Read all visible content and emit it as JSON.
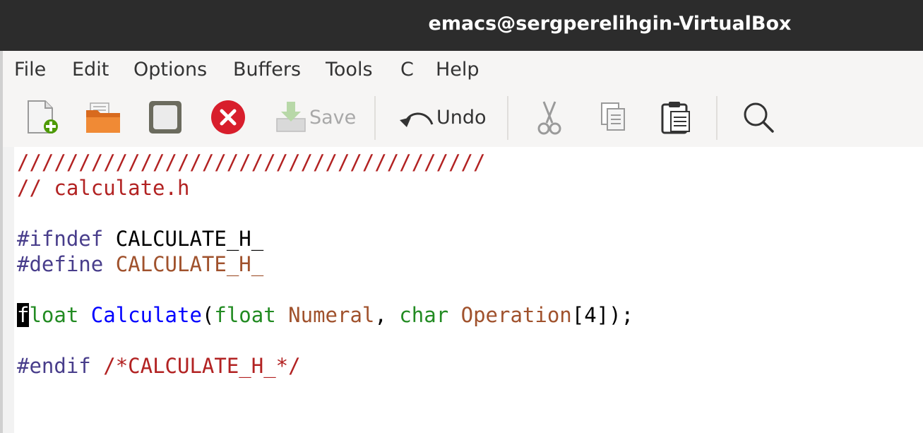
{
  "window": {
    "title": "emacs@sergperelihgin-VirtualBox"
  },
  "menu": {
    "items": [
      "File",
      "Edit",
      "Options",
      "Buffers",
      "Tools",
      "C",
      "Help"
    ]
  },
  "toolbar": {
    "new_icon": "new-file-icon",
    "open_icon": "open-folder-icon",
    "dired_icon": "window-icon",
    "close_icon": "close-icon",
    "save_label": "Save",
    "undo_label": "Undo",
    "cut_icon": "scissors-icon",
    "copy_icon": "copy-icon",
    "paste_icon": "clipboard-icon",
    "search_icon": "search-icon"
  },
  "editor": {
    "lines": {
      "l1": "//////////////////////////////////////",
      "l2": "// calculate.h",
      "l3_kw": "#ifndef",
      "l3_name": "CALCULATE_H_",
      "l4_kw": "#define",
      "l4_name": "CALCULATE_H_",
      "l5_cursor": "f",
      "l5_type1": "loat",
      "l5_fn": "Calculate",
      "l5_p1": "(",
      "l5_type2": "float",
      "l5_var1": "Numeral",
      "l5_p2": ", ",
      "l5_type3": "char",
      "l5_var2": "Operation",
      "l5_p3": "[4]);",
      "l6_kw": "#endif",
      "l6_comment": "/*CALCULATE_H_*/"
    }
  },
  "colors": {
    "comment": "#b22222",
    "preprocessor": "#483d8b",
    "type": "#228b22",
    "function": "#0000ff",
    "variable": "#a0522d"
  }
}
